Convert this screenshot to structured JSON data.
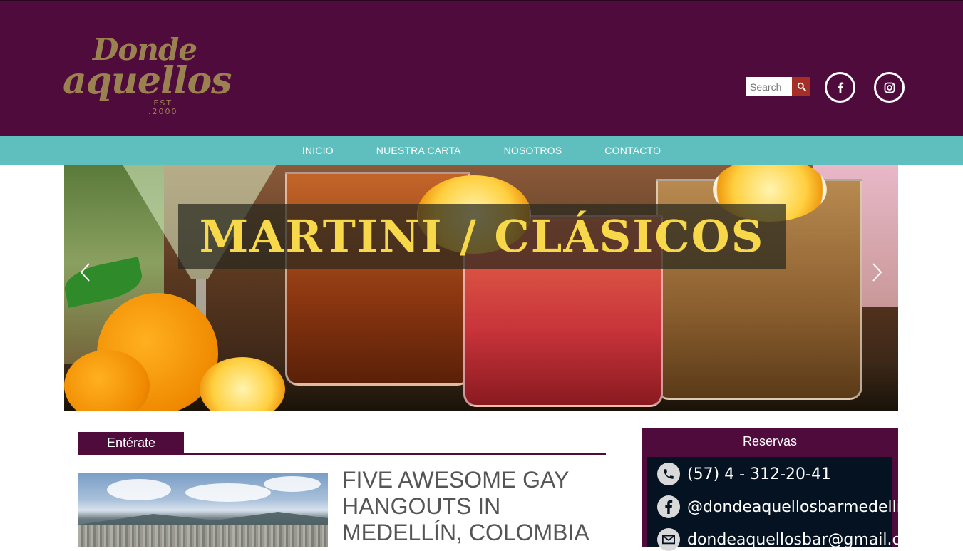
{
  "header": {
    "logo": {
      "line1": "Donde",
      "line2": "aquellos",
      "est": "EST",
      "year": ".2000"
    },
    "search": {
      "placeholder": "Search",
      "button_icon": "search-icon"
    },
    "social": [
      {
        "name": "facebook",
        "icon": "facebook-icon"
      },
      {
        "name": "instagram",
        "icon": "instagram-icon"
      }
    ],
    "colors": {
      "background": "#4e0b3b",
      "logo": "#9a8150",
      "search_button": "#a52e26"
    }
  },
  "nav": {
    "items": [
      {
        "label": "INICIO"
      },
      {
        "label": "NUESTRA CARTA"
      },
      {
        "label": "NOSOTROS"
      },
      {
        "label": "CONTACTO"
      }
    ],
    "color": "#5fbfbf"
  },
  "slider": {
    "banner_text": "MARTINI / CLÁSICOS",
    "prev_icon": "chevron-left-icon",
    "next_icon": "chevron-right-icon",
    "banner_color": "#f6d84a"
  },
  "news": {
    "tab_label": "Entérate",
    "article": {
      "title": "FIVE AWESOME GAY HANGOUTS IN MEDELLÍN, COLOMBIA"
    }
  },
  "reservas": {
    "title": "Reservas",
    "contacts": [
      {
        "icon": "phone-icon",
        "text": "(57)  4 - 312-20-41"
      },
      {
        "icon": "facebook-icon",
        "text": "@dondeaquellosbarmedellin"
      },
      {
        "icon": "mail-icon",
        "text": "dondeaquellosbar@gmail.com"
      }
    ]
  }
}
